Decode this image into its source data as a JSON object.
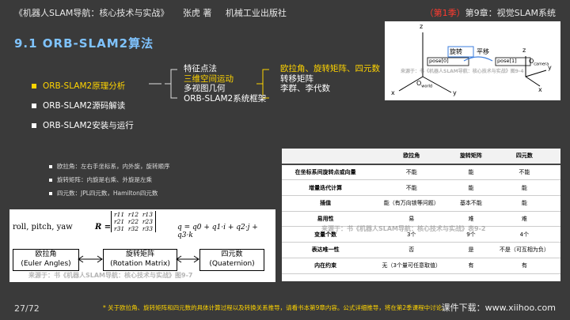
{
  "header": {
    "book": "《机器人SLAM导航：核心技术与实战》",
    "author": "张虎 著",
    "publisher": "机械工业出版社",
    "season": "（第1季）",
    "chapter": "第9章：视觉SLAM系统"
  },
  "section_title": "9.1 ORB-SLAM2算法",
  "menu": [
    {
      "label": "ORB-SLAM2原理分析",
      "active": true
    },
    {
      "label": "ORB-SLAM2源码解读",
      "active": false
    },
    {
      "label": "ORB-SLAM2安装与运行",
      "active": false
    }
  ],
  "topics_col1": [
    "特征点法",
    "三维空间运动",
    "多视图几何",
    "ORB-SLAM2系统框架"
  ],
  "topics_col2": [
    "欧拉角、旋转矩阵、四元数",
    "转移矩阵",
    "李群、李代数"
  ],
  "notes": [
    "欧拉角：左右手坐标系，内外旋，旋转顺序",
    "旋转矩阵：内旋是右乘、外旋是左乘",
    "四元数：JPL四元数，Hamilton四元数"
  ],
  "formula": {
    "left": "roll, pitch, yaw",
    "R": "R =",
    "matrix": [
      [
        "r11",
        "r12",
        "r13"
      ],
      [
        "r21",
        "r22",
        "r23"
      ],
      [
        "r31",
        "r32",
        "r33"
      ]
    ],
    "q": "q = q0 + q1·i + q2·j + q3·k",
    "box1_a": "欧拉角",
    "box1_b": "(Euler Angles)",
    "box2_a": "旋转矩阵",
    "box2_b": "(Rotation Matrix)",
    "box3_a": "四元数",
    "box3_b": "(Quaternion)",
    "source": "来源于：书《机器人SLAM导航：核心技术与实战》图9-7"
  },
  "diagram": {
    "rotate": "旋转",
    "translate": "平移",
    "pose0": "pose[0]",
    "pose1": "pose[1]",
    "oworld": "O",
    "oworld_sub": "world",
    "ocam": "O",
    "ocam_sub": "camera",
    "z": "z",
    "x": "x",
    "y": "y",
    "source": "来源于：书《机器人SLAM导航：核心技术与实战》图9-4"
  },
  "table": {
    "headers": [
      "",
      "欧拉角",
      "旋转矩阵",
      "四元数"
    ],
    "rows": [
      [
        "在坐标系间旋转点或向量",
        "不能",
        "能",
        "不能"
      ],
      [
        "增量迭代计算",
        "不能",
        "能",
        "能"
      ],
      [
        "插值",
        "能（有万向锁等问题）",
        "基本不能",
        "能"
      ],
      [
        "易用性",
        "易",
        "难",
        "难"
      ],
      [
        "变量个数",
        "3个",
        "9个",
        "4个"
      ],
      [
        "表达唯一性",
        "否",
        "是",
        "不是（可互相为负）"
      ],
      [
        "内在约束",
        "无（3个量可任意取值）",
        "有",
        "有"
      ]
    ],
    "source": "来源于：书《机器人SLAM导航：核心技术与实战》表9-2"
  },
  "footer": "* 关于欧拉角、旋转矩阵和四元数的具体计算过程以及转换关系推导，请看书本第9章内容。公式详细推导，将在第2季课程中讨论。",
  "pager": "27/72",
  "download": "课件下载：www.xiihoo.com",
  "colors": {
    "bg": "#3a3a3a",
    "title": "#7fc3ff",
    "accent": "#ffd400",
    "red": "#ff3b30"
  }
}
